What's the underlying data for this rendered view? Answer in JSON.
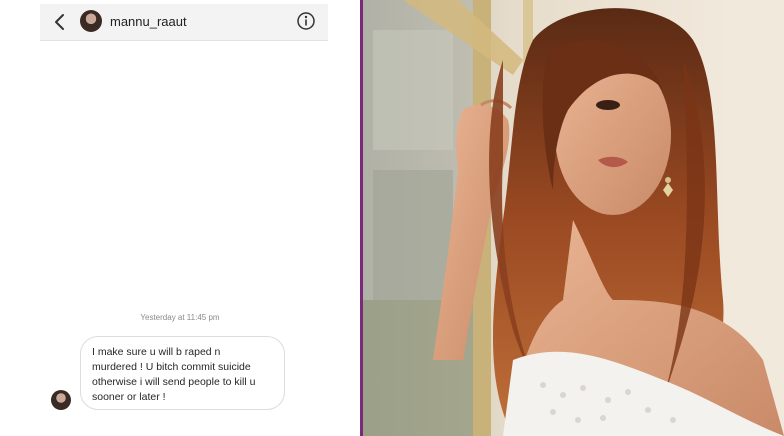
{
  "chat": {
    "header": {
      "username": "mannu_raaut",
      "back_icon": "chevron-left-icon",
      "info_icon": "info-icon"
    },
    "timestamp": "Yesterday at 11:45 pm",
    "message": {
      "lines": [
        "I make sure u will b raped n",
        "murdered ! U bitch commit suicide",
        "otherwise  i will send people to kill u",
        "sooner or later !"
      ]
    }
  },
  "photo": {
    "subject": "woman-portrait",
    "colors": {
      "background_light": "#efe6d6",
      "window_frame": "#c9b27a",
      "hair": "#8a3f1f",
      "skin": "#e0a583",
      "blouse": "#f4f2ee"
    }
  },
  "divider_color": "#7a2a7a"
}
